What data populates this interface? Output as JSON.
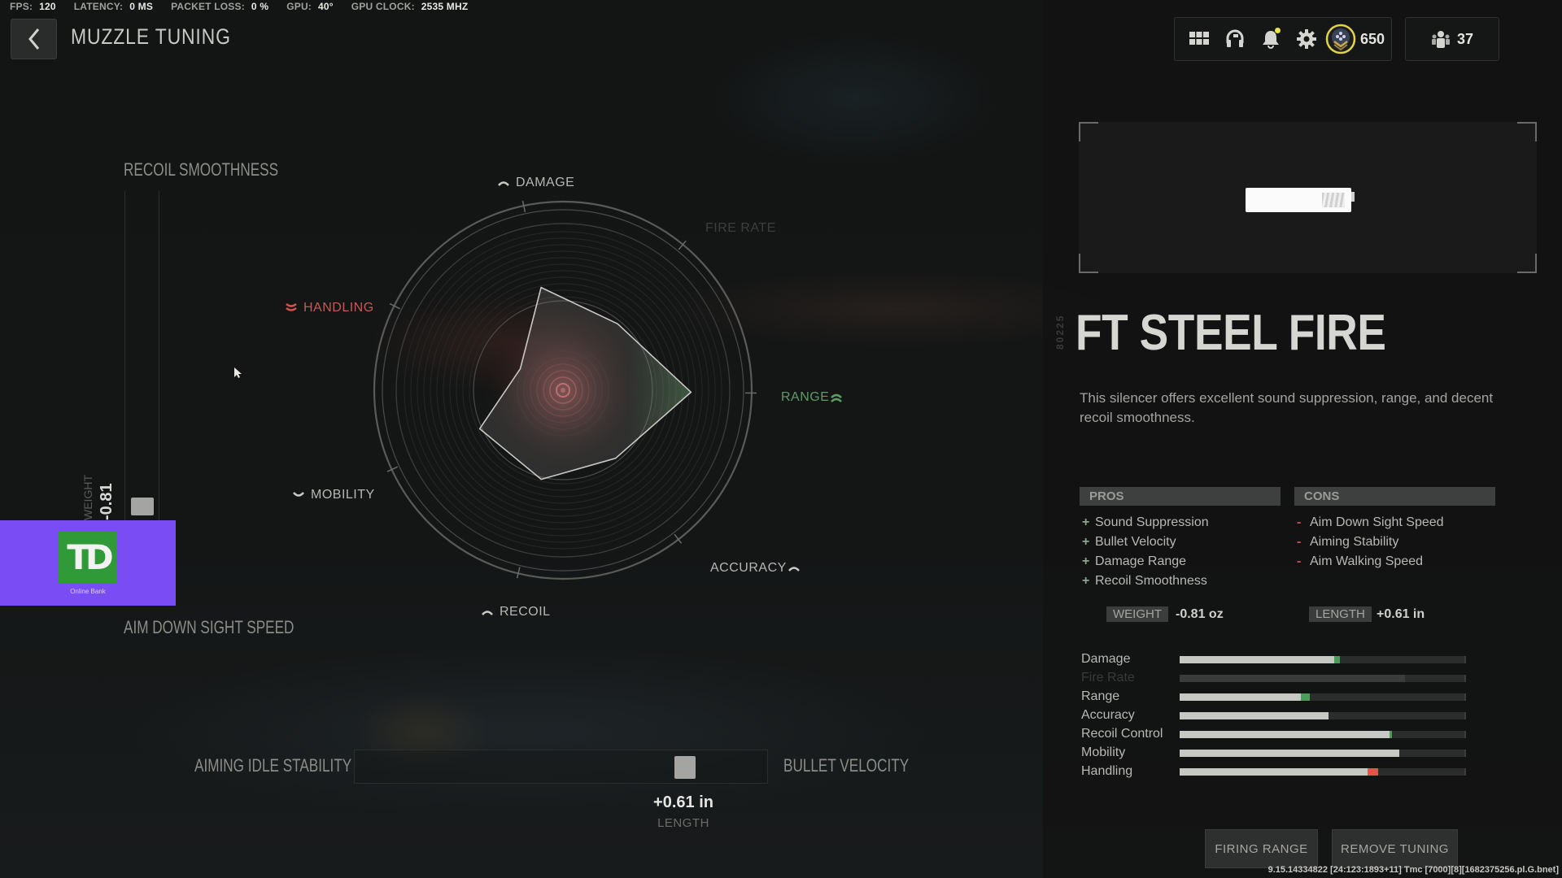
{
  "perf": [
    {
      "label": "FPS:",
      "value": "120"
    },
    {
      "label": "LATENCY:",
      "value": "0 MS"
    },
    {
      "label": "PACKET LOSS:",
      "value": "0 %"
    },
    {
      "label": "GPU:",
      "value": "40°"
    },
    {
      "label": "GPU CLOCK:",
      "value": "2535 MHZ"
    }
  ],
  "header": {
    "title": "MUZZLE TUNING",
    "back_icon": "chevron-left-icon",
    "icons": [
      "grid-menu-icon",
      "headset-icon",
      "bell-icon",
      "gear-icon",
      "rank-badge-icon"
    ],
    "cod_points": "650",
    "party_count": "37",
    "notification_dot_color": "#e8e34a"
  },
  "tuning": {
    "vertical_axis": {
      "top_label": "RECOIL SMOOTHNESS",
      "bottom_label": "AIM DOWN SIGHT SPEED",
      "value": "-0.81",
      "value_unit_label": "WEIGHT",
      "position_fraction": 0.96
    },
    "horizontal_axis": {
      "left_label": "AIMING IDLE STABILITY",
      "right_label": "BULLET VELOCITY",
      "value": "+0.61 in",
      "value_unit_label": "LENGTH",
      "position_fraction": 0.8
    }
  },
  "radar": {
    "axes": [
      {
        "name": "DAMAGE",
        "state": "neutral",
        "indicator": "arc-icon"
      },
      {
        "name": "FIRE RATE",
        "state": "disabled",
        "indicator": ""
      },
      {
        "name": "RANGE",
        "state": "positive",
        "indicator": "double-chevron-up-icon"
      },
      {
        "name": "ACCURACY",
        "state": "neutral",
        "indicator": "arc-icon"
      },
      {
        "name": "RECOIL",
        "state": "neutral",
        "indicator": "arc-icon"
      },
      {
        "name": "MOBILITY",
        "state": "neutral",
        "indicator": "arc-down-icon"
      },
      {
        "name": "HANDLING",
        "state": "negative",
        "indicator": "double-chevron-down-icon"
      }
    ],
    "shape_values": [
      0.55,
      0.45,
      0.67,
      0.45,
      0.48,
      0.48,
      0.25
    ],
    "colors": {
      "positive": "#5e9a66",
      "negative": "#c15b56",
      "neutral": "#b6b6b2"
    }
  },
  "ad": {
    "logo_text": "TD",
    "caption": "Online Bank"
  },
  "attachment": {
    "serial": "80225",
    "name": "FT STEEL FIRE",
    "description": "This silencer offers excellent sound suppression, range, and decent recoil smoothness.",
    "pros_label": "PROS",
    "cons_label": "CONS",
    "pros": [
      "Sound Suppression",
      "Bullet Velocity",
      "Damage Range",
      "Recoil Smoothness"
    ],
    "cons": [
      "Aim Down Sight Speed",
      "Aiming Stability",
      "Aim Walking Speed"
    ],
    "pro_sign": "+",
    "con_sign": "-",
    "weight_label": "WEIGHT",
    "weight_value": "-0.81  oz",
    "length_label": "LENGTH",
    "length_value": "+0.61  in"
  },
  "stats": [
    {
      "name": "Damage",
      "base": 0.54,
      "modified": 0.56,
      "change": "positive",
      "disabled": false
    },
    {
      "name": "Fire Rate",
      "base": 0.79,
      "modified": 0.79,
      "change": "none",
      "disabled": true
    },
    {
      "name": "Range",
      "base": 0.425,
      "modified": 0.455,
      "change": "positive",
      "disabled": false
    },
    {
      "name": "Accuracy",
      "base": 0.52,
      "modified": 0.52,
      "change": "none",
      "disabled": false
    },
    {
      "name": "Recoil Control",
      "base": 0.735,
      "modified": 0.745,
      "change": "positive",
      "disabled": false
    },
    {
      "name": "Mobility",
      "base": 0.77,
      "modified": 0.77,
      "change": "none",
      "disabled": false
    },
    {
      "name": "Handling",
      "base": 0.657,
      "modified": 0.695,
      "change": "negative",
      "disabled": false
    }
  ],
  "stat_colors": {
    "positive": "#4e9a5a",
    "negative": "#e0564c"
  },
  "buttons": {
    "firing_range": "FIRING RANGE",
    "remove_tuning": "REMOVE TUNING"
  },
  "build_string": "9.15.14334822 [24:123:1893+11] Tmc [7000][8][1682375256.pl.G.bnet]"
}
